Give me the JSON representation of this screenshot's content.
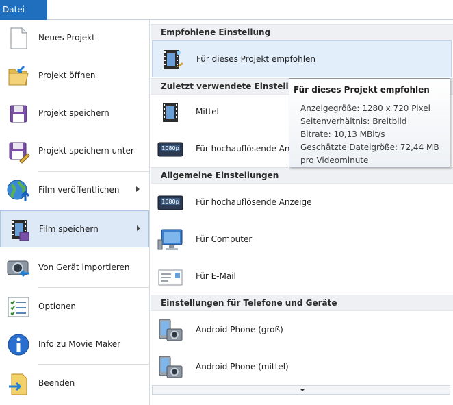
{
  "topbar": {
    "file_tab": "Datei"
  },
  "left_menu": [
    {
      "label": "Neues Projekt",
      "icon": "new-document-icon",
      "access": "N"
    },
    {
      "label": "Projekt öffnen",
      "icon": "open-folder-icon",
      "access": "r"
    },
    {
      "label": "Projekt speichern",
      "icon": "save-disk-icon",
      "access": "s"
    },
    {
      "label": "Projekt speichern unter",
      "icon": "save-as-icon",
      "access": "u"
    },
    {
      "label": "Film veröffentlichen",
      "icon": "globe-upload-icon",
      "access": "v"
    },
    {
      "label": "Film speichern",
      "icon": "film-save-icon",
      "access": "s"
    },
    {
      "label": "Von Gerät importieren",
      "icon": "camera-import-icon",
      "access": "G"
    },
    {
      "label": "Optionen",
      "icon": "checklist-icon",
      "access": "O"
    },
    {
      "label": "Info zu Movie Maker",
      "icon": "info-icon",
      "access": "z"
    },
    {
      "label": "Beenden",
      "icon": "exit-folder-icon",
      "access": "B"
    }
  ],
  "right_menu": {
    "sections": [
      {
        "title": "Empfohlene Einstellung"
      },
      {
        "title": "Zuletzt verwendete Einstellungen"
      },
      {
        "title": "Allgemeine Einstellungen"
      },
      {
        "title": "Einstellungen für Telefone und Geräte"
      }
    ],
    "options": [
      {
        "label": "Für dieses Projekt empfohlen",
        "icon": "recommended-film-icon"
      },
      {
        "label": "Mittel",
        "icon": "film-icon"
      },
      {
        "label": "Für hochauflösende Anzeige",
        "icon": "hd-display-icon"
      },
      {
        "label": "Für hochauflösende Anzeige",
        "icon": "hd-display-icon"
      },
      {
        "label": "Für Computer",
        "icon": "computer-monitor-icon"
      },
      {
        "label": "Für E-Mail",
        "icon": "email-icon"
      },
      {
        "label": "Android Phone (groß)",
        "icon": "phone-camera-icon"
      },
      {
        "label": "Android Phone (mittel)",
        "icon": "phone-camera-icon"
      }
    ]
  },
  "tooltip": {
    "title": "Für dieses Projekt empfohlen",
    "lines": [
      "Anzeigegröße: 1280 x 720 Pixel",
      "Seitenverhältnis: Breitbild",
      "Bitrate: 10,13 MBit/s",
      "Geschätzte Dateigröße: 72,44 MB",
      "pro Videominute"
    ]
  },
  "hd_badge_text": "1080p",
  "colors": {
    "accent": "#1f6fbe",
    "hover_bg": "#dde9f6",
    "hover_border": "#a9c6e6"
  }
}
